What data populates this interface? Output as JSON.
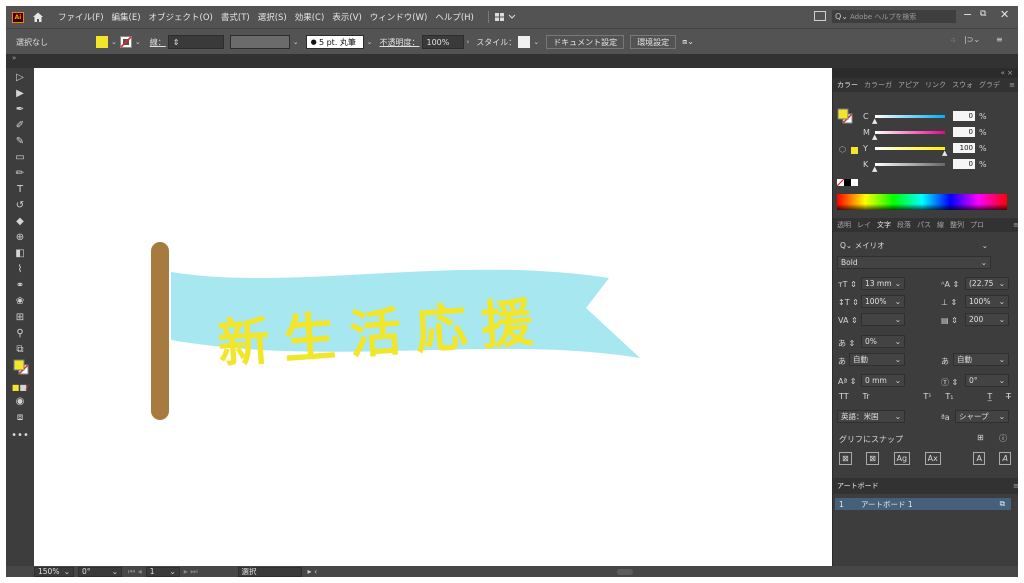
{
  "menubar": {
    "items": [
      "ファイル(F)",
      "編集(E)",
      "オブジェクト(O)",
      "書式(T)",
      "選択(S)",
      "効果(C)",
      "表示(V)",
      "ウィンドウ(W)",
      "ヘルプ(H)"
    ],
    "search_placeholder": "Adobe ヘルプを検索"
  },
  "controlbar": {
    "selection": "選択なし",
    "stroke_label": "線：",
    "brush": "5 pt. 丸筆",
    "opacity_label": "不透明度：",
    "opacity": "100%",
    "style_label": "スタイル：",
    "doc_settings": "ドキュメント設定",
    "prefs": "環境設定"
  },
  "colors": {
    "fill": "#f2e62b",
    "banner": "#a7e7ef",
    "banner_text": "#f2e62b",
    "pole": "#a77b3f"
  },
  "artwork": {
    "banner_text": "新生活応援"
  },
  "color_panel": {
    "tabs": [
      "カラー",
      "カラーガ",
      "アピア",
      "リンク",
      "スウォ",
      "グラデ"
    ],
    "sliders": [
      {
        "label": "C",
        "value": "0",
        "pct": 0,
        "color": "#00aeef"
      },
      {
        "label": "M",
        "value": "0",
        "pct": 0,
        "color": "#ec008c"
      },
      {
        "label": "Y",
        "value": "100",
        "pct": 100,
        "color": "#fff200"
      },
      {
        "label": "K",
        "value": "0",
        "pct": 0,
        "color": "#666666"
      }
    ],
    "unit": "%"
  },
  "char_panel": {
    "tabs": [
      "透明",
      "レイ",
      "文字",
      "段落",
      "パス",
      "線",
      "整列",
      "プロ"
    ],
    "font": "メイリオ",
    "weight": "Bold",
    "size": "13 mm",
    "leading": "(22.75",
    "vscale": "100%",
    "hscale": "100%",
    "tracking": "200",
    "tsume": "0%",
    "mojiaki_left": "自動",
    "mojiaki_right": "自動",
    "baseline": "0 mm",
    "rotation": "0°",
    "language": "英語：米国",
    "aa": "シャープ",
    "snap_label": "グリフにスナップ"
  },
  "artboard_panel": {
    "title": "アートボード",
    "rows": [
      {
        "num": "1",
        "name": "アートボード 1"
      }
    ]
  },
  "statusbar": {
    "zoom": "150%",
    "rotate": "0°",
    "page": "1",
    "tool": "選択"
  }
}
